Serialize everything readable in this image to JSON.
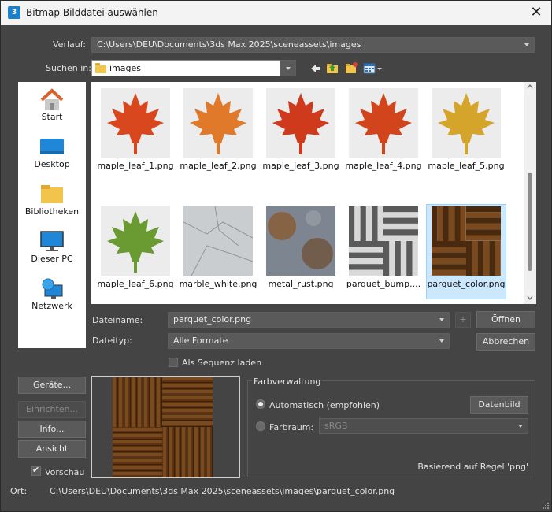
{
  "window": {
    "title": "Bitmap-Bilddatei auswählen",
    "app_icon_text": "3"
  },
  "history": {
    "label": "Verlauf:",
    "value": "C:\\Users\\DEU\\Documents\\3ds Max 2025\\sceneassets\\images"
  },
  "lookin": {
    "label": "Suchen in:",
    "value": "images"
  },
  "places": [
    {
      "label": "Start"
    },
    {
      "label": "Desktop"
    },
    {
      "label": "Bibliotheken"
    },
    {
      "label": "Dieser PC"
    },
    {
      "label": "Netzwerk"
    }
  ],
  "files": [
    {
      "name": "maple_leaf_1.png",
      "color": "#d9471f"
    },
    {
      "name": "maple_leaf_2.png",
      "color": "#e07a2a"
    },
    {
      "name": "maple_leaf_3.png",
      "color": "#cf3a1d"
    },
    {
      "name": "maple_leaf_4.png",
      "color": "#d2451c"
    },
    {
      "name": "maple_leaf_5.png",
      "color": "#d4a52a"
    },
    {
      "name": "maple_leaf_6.png",
      "color": "#6a9a32"
    },
    {
      "name": "marble_white.png",
      "color": "#c9cdd0"
    },
    {
      "name": "metal_rust.png",
      "color": "#7f6a5a"
    },
    {
      "name": "parquet_bump....",
      "color": "#8c8c8c"
    },
    {
      "name": "parquet_color.png",
      "color": "#6b3d17"
    }
  ],
  "filename": {
    "label": "Dateiname:",
    "value": "parquet_color.png",
    "plus": "+",
    "open_button": "Öffnen"
  },
  "filetype": {
    "label": "Dateityp:",
    "value": "Alle Formate",
    "cancel_button": "Abbrechen"
  },
  "sequence": {
    "label": "Als Sequenz laden"
  },
  "left_buttons": {
    "devices": "Geräte...",
    "setup": "Einrichten...",
    "info": "Info...",
    "view": "Ansicht",
    "preview_label": "Vorschau"
  },
  "color_mgmt": {
    "title": "Farbverwaltung",
    "auto_label": "Automatisch (empfohlen)",
    "data_button": "Datenbild",
    "space_label": "Farbraum:",
    "space_value": "sRGB",
    "rule_text": "Basierend auf Regel 'png'"
  },
  "location": {
    "label": "Ort:",
    "value": "C:\\Users\\DEU\\Documents\\3ds Max 2025\\sceneassets\\images\\parquet_color.png"
  }
}
